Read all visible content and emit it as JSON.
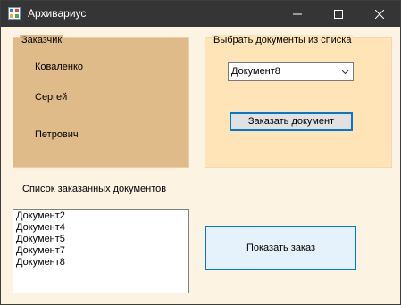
{
  "window": {
    "title": "Архивариус"
  },
  "customer_group": {
    "title": "Заказчик",
    "surname": "Коваленко",
    "name": "Сергей",
    "patronymic": "Петрович"
  },
  "documents_group": {
    "title": "Выбрать документы из списка",
    "selected_document": "Документ8",
    "order_button": "Заказать документ"
  },
  "ordered_list": {
    "label": "Список заказанных документов",
    "items": [
      "Документ2",
      "Документ4",
      "Документ5",
      "Документ7",
      "Документ8"
    ]
  },
  "show_order_button": "Показать заказ",
  "colors": {
    "titlebar": "#353535",
    "form_background": "#fdf3e3",
    "customer_group_bg": "#dfbb8a",
    "documents_group_bg": "#fee4b6",
    "accent": "#0078d7"
  },
  "icons": {
    "app": "app-icon",
    "minimize": "minimize-icon",
    "maximize": "maximize-icon",
    "close": "close-icon",
    "dropdown": "chevron-down-icon"
  }
}
